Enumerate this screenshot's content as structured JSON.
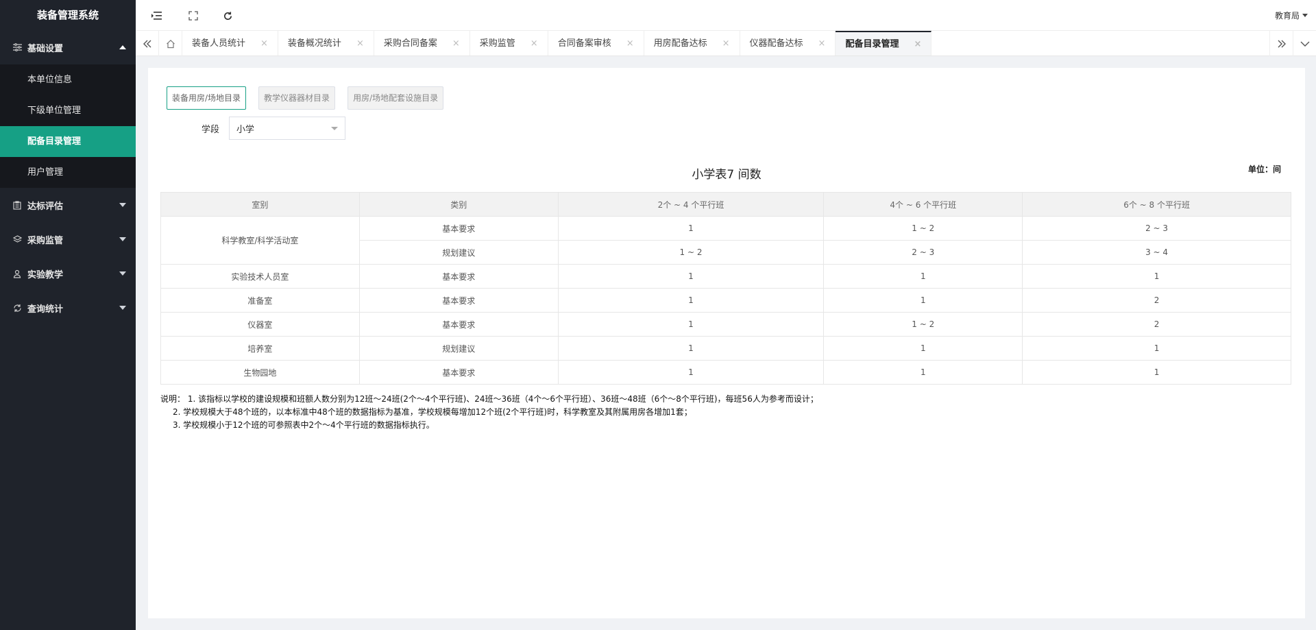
{
  "app": {
    "title": "装备管理系统"
  },
  "sidebar": {
    "groups": [
      {
        "label": "基础设置",
        "icon": "sliders-icon",
        "expanded": true,
        "items": [
          {
            "label": "本单位信息",
            "active": false
          },
          {
            "label": "下级单位管理",
            "active": false
          },
          {
            "label": "配备目录管理",
            "active": true
          },
          {
            "label": "用户管理",
            "active": false
          }
        ]
      },
      {
        "label": "达标评估",
        "icon": "clipboard-icon",
        "expanded": false
      },
      {
        "label": "采购监管",
        "icon": "layers-icon",
        "expanded": false
      },
      {
        "label": "实验教学",
        "icon": "flask-icon",
        "expanded": false
      },
      {
        "label": "查询统计",
        "icon": "refresh-icon",
        "expanded": false
      }
    ]
  },
  "header": {
    "user": "教育局"
  },
  "tabs": [
    {
      "label": "装备人员统计"
    },
    {
      "label": "装备概况统计"
    },
    {
      "label": "采购合同备案"
    },
    {
      "label": "采购监管"
    },
    {
      "label": "合同备案审核"
    },
    {
      "label": "用房配备达标"
    },
    {
      "label": "仪器配备达标"
    },
    {
      "label": "配备目录管理",
      "active": true
    }
  ],
  "tab_close": "×",
  "catalog": {
    "buttons": [
      {
        "label": "装备用房/场地目录",
        "active": true
      },
      {
        "label": "教学仪器器材目录",
        "active": false
      },
      {
        "label": "用房/场地配套设施目录",
        "active": false
      }
    ],
    "filter": {
      "label": "学段",
      "value": "小学"
    }
  },
  "table": {
    "title": "小学表7 间数",
    "unit": "单位：间",
    "headers": [
      "室别",
      "类别",
      "2个 ~ 4 个平行班",
      "4个 ~ 6 个平行班",
      "6个 ~ 8 个平行班"
    ],
    "rows": [
      {
        "room": "科学教室/科学活动室",
        "rowspan": 2,
        "type": "基本要求",
        "c1": "1",
        "c2": "1 ~ 2",
        "c3": "2 ~ 3"
      },
      {
        "room": null,
        "type": "规划建议",
        "c1": "1 ~ 2",
        "c2": "2 ~ 3",
        "c3": "3 ~ 4"
      },
      {
        "room": "实验技术人员室",
        "rowspan": 1,
        "type": "基本要求",
        "c1": "1",
        "c2": "1",
        "c3": "1"
      },
      {
        "room": "准备室",
        "rowspan": 1,
        "type": "基本要求",
        "c1": "1",
        "c2": "1",
        "c3": "2"
      },
      {
        "room": "仪器室",
        "rowspan": 1,
        "type": "基本要求",
        "c1": "1",
        "c2": "1 ~ 2",
        "c3": "2"
      },
      {
        "room": "培养室",
        "rowspan": 1,
        "type": "规划建议",
        "c1": "1",
        "c2": "1",
        "c3": "1"
      },
      {
        "room": "生物园地",
        "rowspan": 1,
        "type": "基本要求",
        "c1": "1",
        "c2": "1",
        "c3": "1"
      }
    ]
  },
  "notes": [
    "说明：  1. 该指标以学校的建设规模和班额人数分别为12班～24班(2个～4个平行班)、24班～36班（4个～6个平行班）、36班～48班（6个～8个平行班)，每班56人为参考而设计；",
    "2. 学校规模大于48个班的，以本标准中48个班的数据指标为基准，学校规模每增加12个班(2个平行班)时，科学教室及其附属用房各增加1套；",
    "3. 学校规模小于12个班的可参照表中2个～4个平行班的数据指标执行。"
  ]
}
